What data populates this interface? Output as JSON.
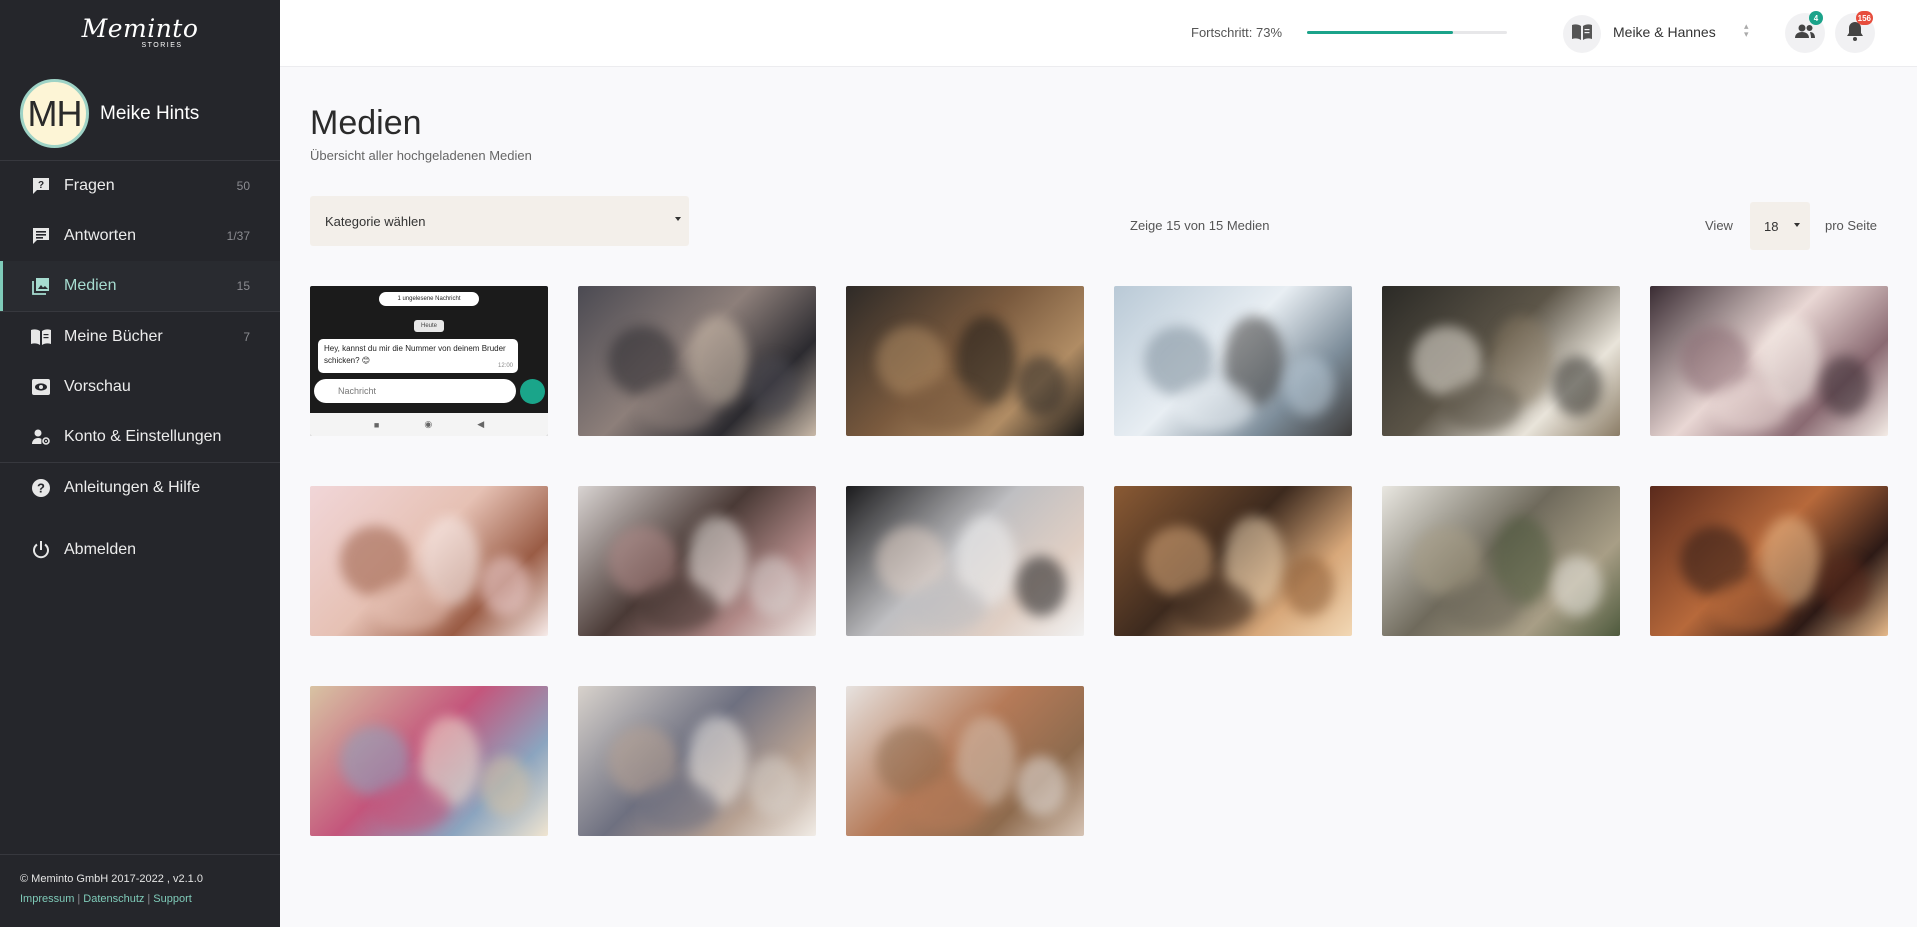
{
  "sidebar": {
    "logo_text": "Meminto",
    "logo_sub": "STORIES",
    "user": {
      "initials": "MH",
      "name": "Meike Hints"
    },
    "nav": [
      {
        "label": "Fragen",
        "count": "50",
        "icon": "question-icon"
      },
      {
        "label": "Antworten",
        "count": "1/37",
        "icon": "chat-icon"
      },
      {
        "label": "Medien",
        "count": "15",
        "icon": "image-icon",
        "active": true
      },
      {
        "label": "Meine Bücher",
        "count": "7",
        "icon": "book-icon"
      },
      {
        "label": "Vorschau",
        "count": "",
        "icon": "eye-icon"
      },
      {
        "label": "Konto & Einstellungen",
        "count": "",
        "icon": "user-settings-icon"
      },
      {
        "label": "Anleitungen & Hilfe",
        "count": "",
        "icon": "help-icon"
      },
      {
        "label": "Abmelden",
        "count": "",
        "icon": "power-icon"
      }
    ],
    "footer": {
      "copyright": "© Meminto GmbH 2017-2022 , v2.1.0",
      "links": [
        "Impressum",
        "Datenschutz",
        "Support"
      ]
    }
  },
  "topbar": {
    "progress_label": "Fortschritt: 73%",
    "progress_value": 0.73,
    "book_name": "Meike & Hannes",
    "friends_badge": "4",
    "notifications_badge": "156",
    "accent": "#1ba38a"
  },
  "main": {
    "title": "Medien",
    "subtitle": "Übersicht aller hochgeladenen Medien",
    "category_select": "Kategorie wählen",
    "count_text": "Zeige 15 von 15 Medien",
    "view_label": "View",
    "per_page": "18",
    "per_page_suffix": "pro Seite",
    "media": [
      {
        "kind": "chat-screenshot",
        "top_pill": "1 ungelesene Nachricht",
        "day": "Heute",
        "message": "Hey, kannst du mir die Nummer von deinem Bruder schicken? 😊",
        "time": "12:00",
        "input_placeholder": "Nachricht"
      },
      {
        "kind": "photo",
        "subject": "party-kitchen",
        "palette": [
          "#4b4a52",
          "#8d7f7a",
          "#2c2b30",
          "#c9b9a8"
        ]
      },
      {
        "kind": "photo",
        "subject": "cafe-friends",
        "palette": [
          "#2e2a27",
          "#7a5a3e",
          "#b08c64",
          "#1c1a18"
        ]
      },
      {
        "kind": "photo",
        "subject": "friends-laughing-wall",
        "palette": [
          "#b9c9d6",
          "#e8eef3",
          "#7d8d9a",
          "#3d3b3a"
        ]
      },
      {
        "kind": "photo",
        "subject": "couple-laughing-cafe",
        "palette": [
          "#2b2a26",
          "#5c5548",
          "#e9e4da",
          "#8a7c66"
        ]
      },
      {
        "kind": "photo",
        "subject": "wedding-cake",
        "palette": [
          "#3a2c33",
          "#e9d7d4",
          "#8a6a72",
          "#f4ece6"
        ]
      },
      {
        "kind": "photo",
        "subject": "wedding-table-flowers",
        "palette": [
          "#f1d6d8",
          "#e6c1b4",
          "#9a5c45",
          "#f7ecea"
        ]
      },
      {
        "kind": "photo",
        "subject": "love-letters",
        "palette": [
          "#d9d4d2",
          "#4a3a36",
          "#b28a88",
          "#efeae6"
        ]
      },
      {
        "kind": "photo",
        "subject": "wedding-shoes-bouquet",
        "palette": [
          "#1b1b1d",
          "#bfbfc2",
          "#e0cfc4",
          "#f2f2f2"
        ]
      },
      {
        "kind": "photo",
        "subject": "christmas-family-dinner",
        "palette": [
          "#8a5a34",
          "#3d2a1e",
          "#d8a87a",
          "#f2d8b5"
        ]
      },
      {
        "kind": "photo",
        "subject": "garden-party",
        "palette": [
          "#e9e7e1",
          "#6f6a5c",
          "#a89e86",
          "#4e5a3d"
        ]
      },
      {
        "kind": "photo",
        "subject": "christmas-dinner-lights",
        "palette": [
          "#5a2a1c",
          "#b7693b",
          "#2d1a16",
          "#e6b98a"
        ]
      },
      {
        "kind": "photo",
        "subject": "girl-pink-kiss",
        "palette": [
          "#d8c3a3",
          "#c4567c",
          "#8ba4bf",
          "#f0e5d1"
        ]
      },
      {
        "kind": "photo",
        "subject": "grandparents-kids",
        "palette": [
          "#d8d2cc",
          "#6e7080",
          "#b8a293",
          "#f1ece6"
        ]
      },
      {
        "kind": "photo",
        "subject": "children-playing",
        "palette": [
          "#e7e2df",
          "#b57a58",
          "#8e6b4e",
          "#d6c4b5"
        ]
      }
    ]
  }
}
